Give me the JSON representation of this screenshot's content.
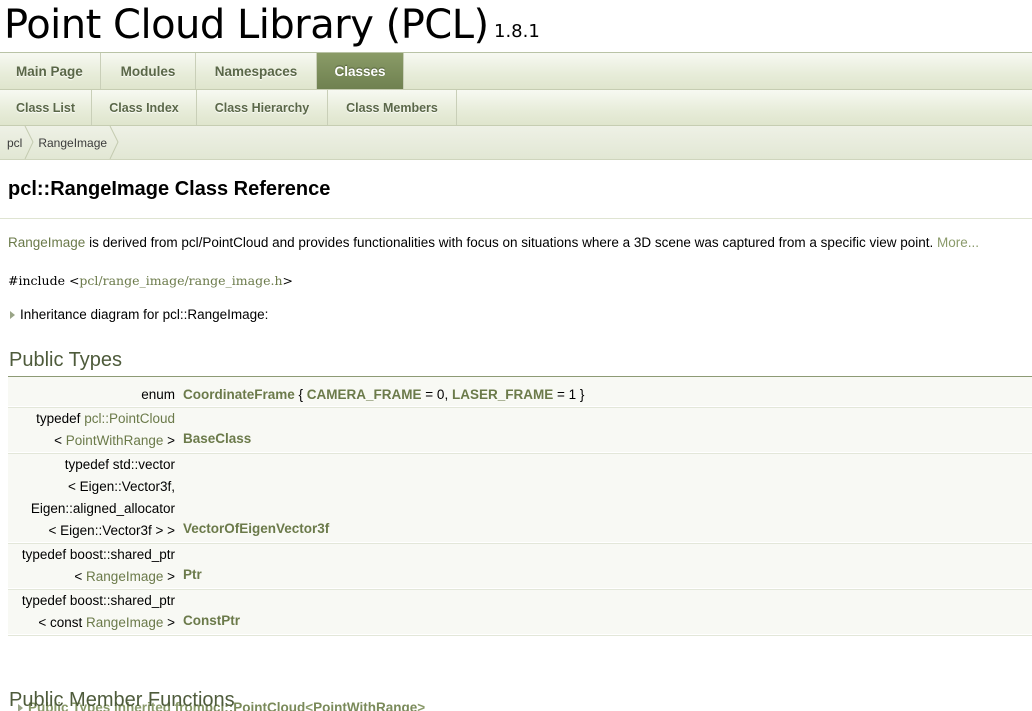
{
  "project": {
    "name": "Point Cloud Library (PCL)",
    "number": "1.8.1"
  },
  "tabs": [
    {
      "label": "Main Page"
    },
    {
      "label": "Modules"
    },
    {
      "label": "Namespaces"
    },
    {
      "label": "Classes",
      "current": true
    }
  ],
  "subtabs": [
    {
      "label": "Class List"
    },
    {
      "label": "Class Index"
    },
    {
      "label": "Class Hierarchy"
    },
    {
      "label": "Class Members"
    }
  ],
  "breadcrumb": [
    {
      "label": "pcl"
    },
    {
      "label": "RangeImage"
    }
  ],
  "header": {
    "title": "pcl::RangeImage Class Reference"
  },
  "brief": {
    "link": "RangeImage",
    "text": " is derived from pcl/PointCloud and provides functionalities with focus on situations where a 3D scene was captured from a specific view point. ",
    "more": "More..."
  },
  "include": {
    "prefix": "#include <",
    "path": "pcl/range_image/range_image.h",
    "suffix": ">"
  },
  "inheritance": {
    "label": "Inheritance diagram for pcl::RangeImage:"
  },
  "sections": {
    "public_types": "Public Types",
    "public_member_functions": "Public Member Functions"
  },
  "members": {
    "enum_kw": "enum ",
    "enum_name": "CoordinateFrame",
    "enum_open": " { ",
    "enum_v1": "CAMERA_FRAME",
    "enum_v1_val": " = 0, ",
    "enum_v2": "LASER_FRAME",
    "enum_v2_val": " = 1 }",
    "bc_l1_pre": "typedef ",
    "bc_l1_link": "pcl::PointCloud",
    "bc_l2_pre": "< ",
    "bc_l2_link": "PointWithRange",
    "bc_l2_post": " > ",
    "bc_name": "BaseClass",
    "vec_l1": "typedef std::vector",
    "vec_l2": "< Eigen::Vector3f,",
    "vec_l3": "Eigen::aligned_allocator",
    "vec_l4": "< Eigen::Vector3f > > ",
    "vec_name": "VectorOfEigenVector3f",
    "ptr_l1": "typedef boost::shared_ptr",
    "ptr_l2_pre": "< ",
    "ptr_l2_link": "RangeImage",
    "ptr_l2_post": " > ",
    "ptr_name": "Ptr",
    "cptr_l1": "typedef boost::shared_ptr",
    "cptr_l2_pre": "< const ",
    "cptr_l2_link": "RangeImage",
    "cptr_l2_post": " > ",
    "cptr_name": "ConstPtr"
  },
  "inherited": {
    "prefix": "Public Types inherited from ",
    "link1": "pcl::PointCloud",
    "mid": "< ",
    "link2": "PointWithRange",
    "suffix": " >"
  }
}
